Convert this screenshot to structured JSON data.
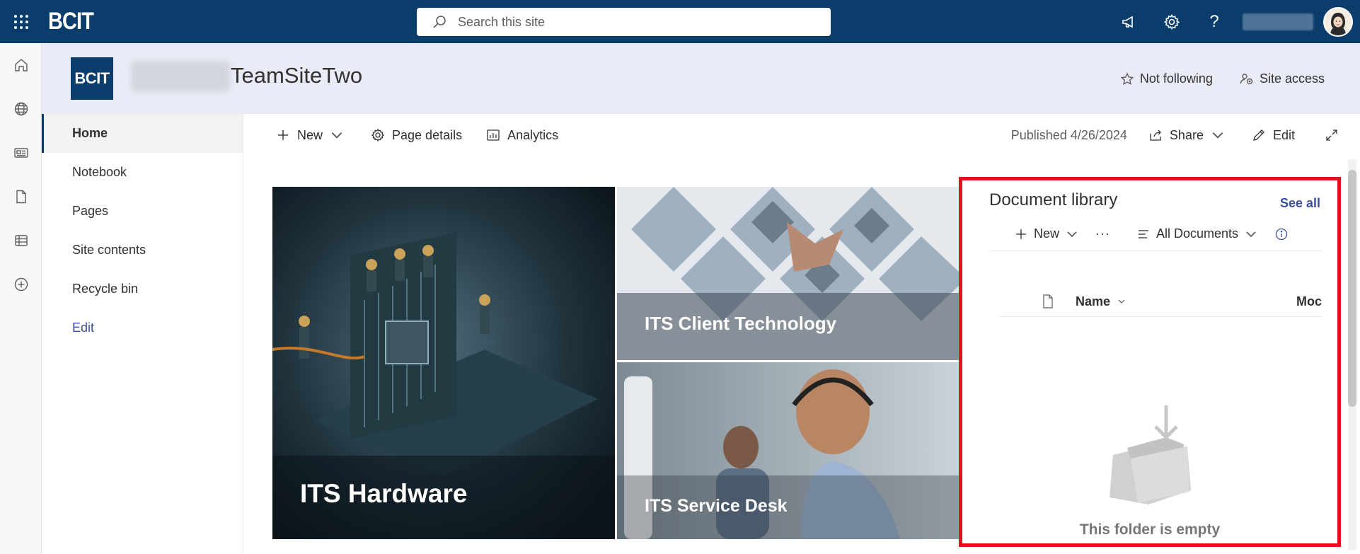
{
  "suite": {
    "brand": "BCIT",
    "search_placeholder": "Search this site"
  },
  "appbar": {
    "icons": [
      "home-icon",
      "globe-icon",
      "news-icon",
      "document-icon",
      "list-icon",
      "add-icon"
    ]
  },
  "site": {
    "logo_text": "BCIT",
    "title": "TeamSiteTwo",
    "not_following": "Not following",
    "site_access": "Site access"
  },
  "nav": {
    "items": [
      {
        "label": "Home"
      },
      {
        "label": "Notebook"
      },
      {
        "label": "Pages"
      },
      {
        "label": "Site contents"
      },
      {
        "label": "Recycle bin"
      },
      {
        "label": "Edit"
      }
    ]
  },
  "commands": {
    "new_label": "New",
    "page_details_label": "Page details",
    "analytics_label": "Analytics",
    "published": "Published 4/26/2024",
    "share_label": "Share",
    "edit_label": "Edit"
  },
  "hero": {
    "tiles": [
      {
        "title": "ITS Hardware"
      },
      {
        "title": "ITS Client Technology"
      },
      {
        "title": "ITS Service Desk"
      }
    ]
  },
  "doclib": {
    "title": "Document library",
    "see_all": "See all",
    "new_label": "New",
    "more_label": "···",
    "view_label": "All Documents",
    "col_name": "Name",
    "col_modified": "Moc",
    "empty_text": "This folder is empty"
  },
  "colors": {
    "suite_bar": "#0a3d6b",
    "site_header": "#e9ebf6",
    "highlight_border": "#e0141e",
    "link": "#3b4ea0"
  }
}
